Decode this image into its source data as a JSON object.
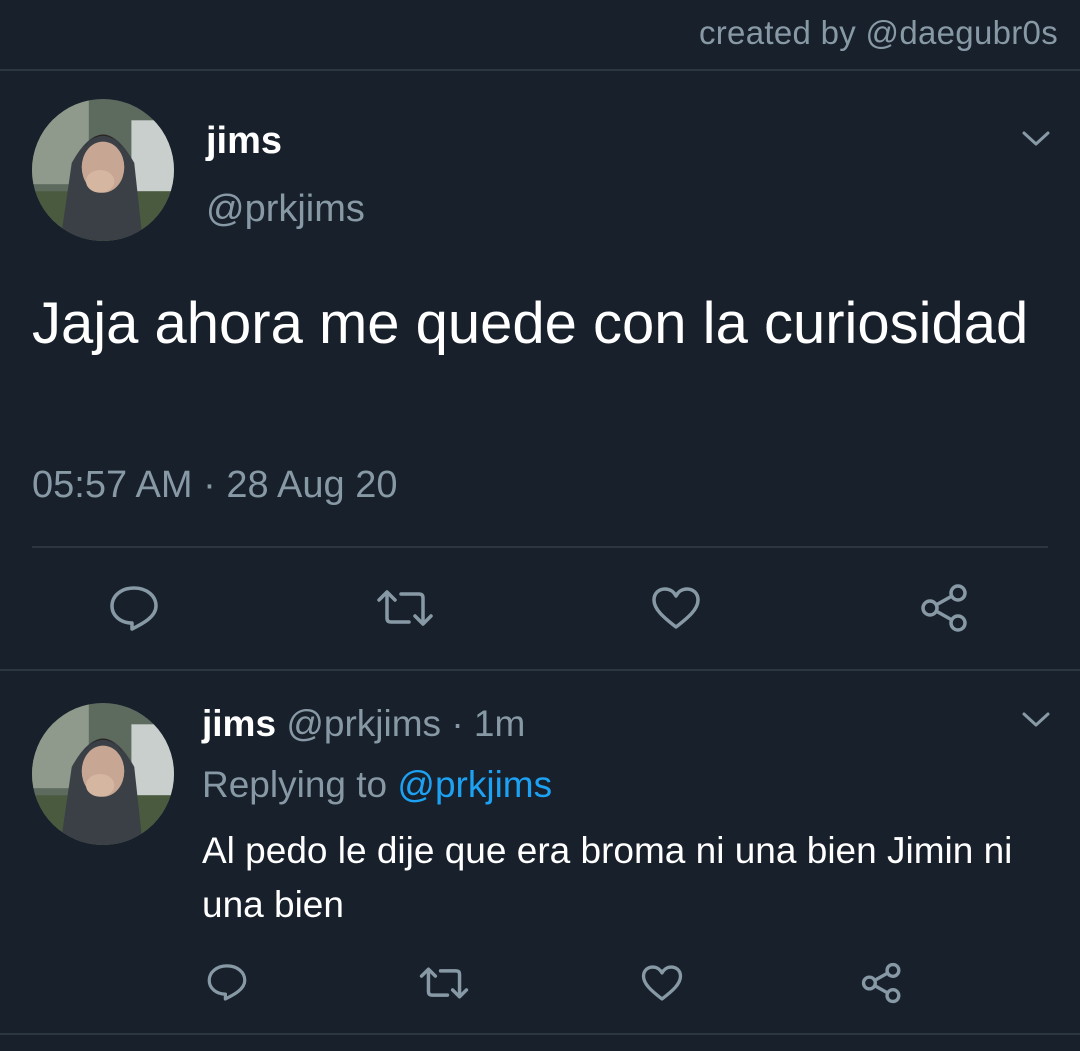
{
  "credit": "created by @daegubr0s",
  "tweet": {
    "name": "jims",
    "handle": "@prkjims",
    "text": "Jaja ahora me quede con la curiosidad",
    "timestamp": "05:57 AM · 28 Aug 20"
  },
  "reply": {
    "name": "jims",
    "meta": "@prkjims · 1m",
    "replying_prefix": "Replying to ",
    "replying_handle": "@prkjims",
    "text": "Al pedo le dije que era broma ni una bien Jimin ni una bien"
  },
  "actions": [
    "reply-icon",
    "retweet-icon",
    "like-icon",
    "share-icon"
  ],
  "colors": {
    "background": "#17202b",
    "muted": "#8899a6",
    "accent": "#1da1f2",
    "separator": "#2b3641"
  }
}
